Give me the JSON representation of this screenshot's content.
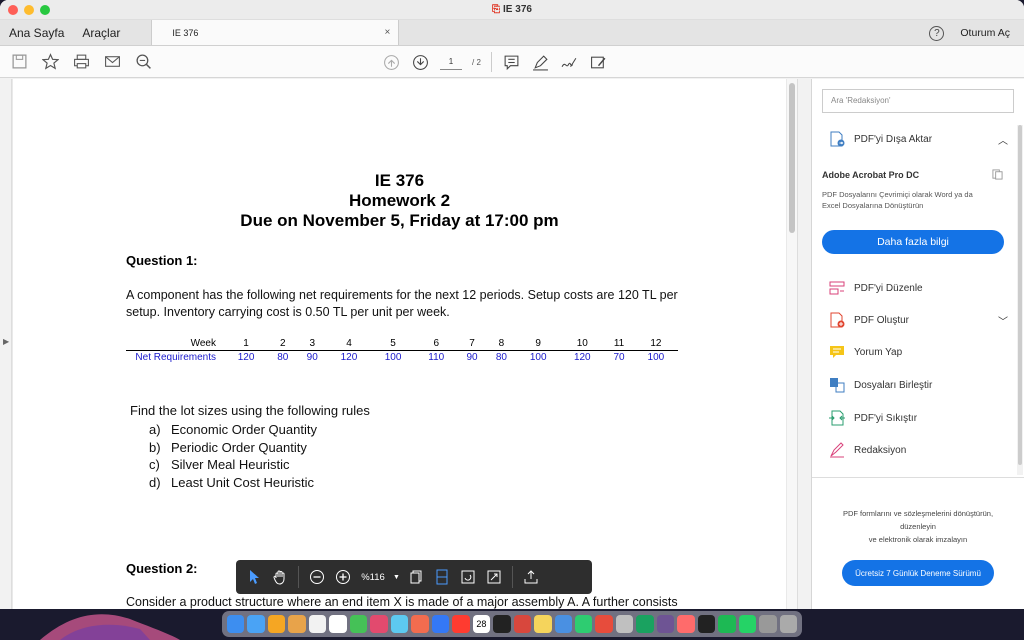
{
  "window": {
    "title": "IE 376"
  },
  "tabs": {
    "home": "Ana Sayfa",
    "tools": "Araçlar",
    "document": "IE 376",
    "close": "×"
  },
  "account": {
    "signin": "Oturum Aç",
    "help": "?"
  },
  "toolbar": {
    "page_current": "1",
    "page_total": "/ 2"
  },
  "document": {
    "title": "IE 376",
    "subtitle": "Homework 2",
    "due": "Due on November 5, Friday at 17:00 pm",
    "q1_heading": "Question 1:",
    "q1_text": "A component has the following net requirements for the next 12 periods. Setup costs are 120 TL per setup. Inventory carrying cost is 0.50 TL per unit per week.",
    "table": {
      "week_label": "Week",
      "req_label": "Net Requirements",
      "weeks": [
        "1",
        "2",
        "3",
        "4",
        "5",
        "6",
        "7",
        "8",
        "9",
        "10",
        "11",
        "12"
      ],
      "requirements": [
        "120",
        "80",
        "90",
        "120",
        "100",
        "110",
        "90",
        "80",
        "100",
        "120",
        "70",
        "100"
      ]
    },
    "find_text": "Find the lot sizes using the following rules",
    "rules": [
      {
        "letter": "a)",
        "text": "Economic Order Quantity"
      },
      {
        "letter": "b)",
        "text": "Periodic Order Quantity"
      },
      {
        "letter": "c)",
        "text": "Silver Meal Heuristic"
      },
      {
        "letter": "d)",
        "text": "Least Unit Cost Heuristic"
      }
    ],
    "q2_heading": "Question 2:",
    "q2_text": "Consider a product structure where an end item X is made of a major assembly A. A further consists"
  },
  "floatbar": {
    "zoom": "%116"
  },
  "side_panel": {
    "search_placeholder": "Ara 'Redaksiyon'",
    "export_label": "PDF'yi Dışa Aktar",
    "promo_title": "Adobe Acrobat Pro DC",
    "promo_desc": "PDF Dosyalarını Çevrimiçi olarak Word ya da Excel Dosyalarına Dönüştürün",
    "promo_button": "Daha fazla bilgi",
    "items": [
      {
        "label": "PDF'yi Düzenle"
      },
      {
        "label": "PDF Oluştur"
      },
      {
        "label": "Yorum Yap"
      },
      {
        "label": "Dosyaları Birleştir"
      },
      {
        "label": "PDF'yi Sıkıştır"
      },
      {
        "label": "Redaksiyon"
      }
    ],
    "footer_line1": "PDF formlarını ve sözleşmelerini dönüştürün,",
    "footer_line2": "düzenleyin",
    "footer_line3": "ve elektronik olarak imzalayın",
    "trial_button": "Ücretsiz 7 Günlük Deneme Sürümü"
  },
  "dock": {
    "calendar_day": "28"
  },
  "colors": {
    "accent": "#1473e6",
    "table_values": "#1a1acc"
  }
}
